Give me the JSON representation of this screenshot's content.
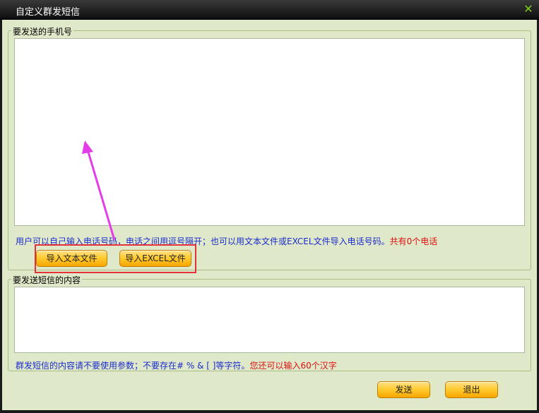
{
  "window": {
    "title": "自定义群发短信",
    "close_icon": "✕"
  },
  "phone_group": {
    "legend": "要发送的手机号",
    "text_value": "",
    "hint_blue": "用户可以自己输入电话号码，电话之间用逗号隔开；也可以用文本文件或EXCEL文件导入电话号码。",
    "hint_red": "共有0个电话",
    "import_text_label": "导入文本文件",
    "import_excel_label": "导入EXCEL文件"
  },
  "content_group": {
    "legend": "要发送短信的内容",
    "text_value": "",
    "hint_blue": "群发短信的内容请不要使用参数；不要存在# % & [ ]等字符。",
    "hint_red": "您还可以输入60个汉字"
  },
  "footer": {
    "send_label": "发送",
    "exit_label": "退出"
  },
  "annotation": {
    "arrow_color": "#e33ce8",
    "box_color": "#e5303a"
  }
}
